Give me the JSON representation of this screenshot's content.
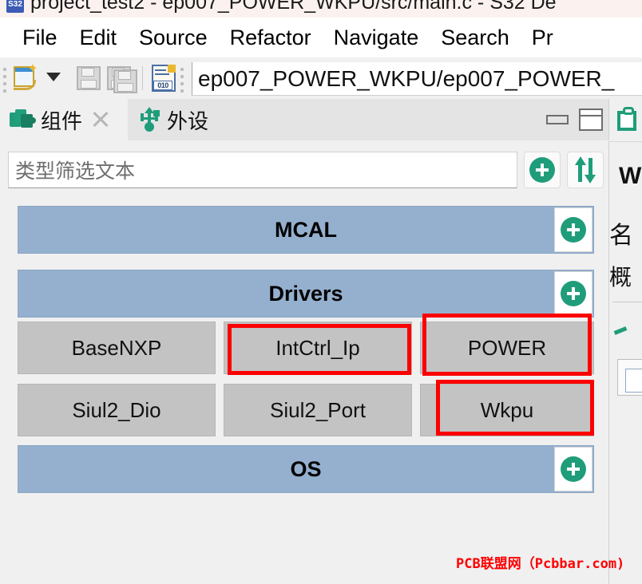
{
  "window": {
    "title": "project_test2 - ep007_POWER_WKPU/src/main.c - S32 De",
    "app_icon": "S32"
  },
  "menubar": {
    "items": [
      {
        "label": "File"
      },
      {
        "label": "Edit"
      },
      {
        "label": "Source"
      },
      {
        "label": "Refactor"
      },
      {
        "label": "Navigate"
      },
      {
        "label": "Search"
      },
      {
        "label": "Pr"
      }
    ]
  },
  "toolbar": {
    "new_icon": "new-file-icon",
    "dropdown_icon": "chevron-down-icon",
    "save_icon": "save-icon",
    "save_all_icon": "save-all-icon",
    "binary_icon": "binary-file-icon",
    "path_field_value": "ep007_POWER_WKPU/ep007_POWER_"
  },
  "view": {
    "tabs": [
      {
        "label": "组件",
        "icon": "components-icon",
        "active": true,
        "closable": true
      },
      {
        "label": "外设",
        "icon": "usb-peripherals-icon",
        "active": false,
        "closable": false
      }
    ],
    "controls": [
      {
        "name": "minimize-view-button",
        "icon": "minimize-icon"
      },
      {
        "name": "maximize-view-button",
        "icon": "maximize-icon"
      }
    ],
    "filter": {
      "placeholder": "类型筛选文本",
      "value": ""
    },
    "filter_buttons": [
      {
        "name": "add-component-button",
        "icon": "plus-circle-icon"
      },
      {
        "name": "sort-button",
        "icon": "sort-arrows-icon"
      }
    ]
  },
  "groups": [
    {
      "title": "MCAL",
      "add_icon": "plus-circle-icon",
      "tiles": []
    },
    {
      "title": "Drivers",
      "add_icon": "plus-circle-icon",
      "tiles": [
        {
          "label": "BaseNXP",
          "highlighted": false
        },
        {
          "label": "IntCtrl_Ip",
          "highlighted": true
        },
        {
          "label": "POWER",
          "highlighted": true
        },
        {
          "label": "Siul2_Dio",
          "highlighted": false
        },
        {
          "label": "Siul2_Port",
          "highlighted": false
        },
        {
          "label": "Wkpu",
          "highlighted": true
        }
      ]
    },
    {
      "title": "OS",
      "add_icon": "plus-circle-icon",
      "tiles": []
    }
  ],
  "right_panel": {
    "tab_icon": "clipboard-icon",
    "title": "W",
    "line1": "名",
    "line2": "概",
    "check_icon": "check-icon"
  },
  "watermark": {
    "text": "PCB联盟网（Pcbbar.com)"
  },
  "colors": {
    "group_header": "#95b0ce",
    "tile": "#c3c3c3",
    "accent_green": "#1f9d7a",
    "annotation_red": "#fb0000",
    "watermark_red": "#ff0000"
  }
}
